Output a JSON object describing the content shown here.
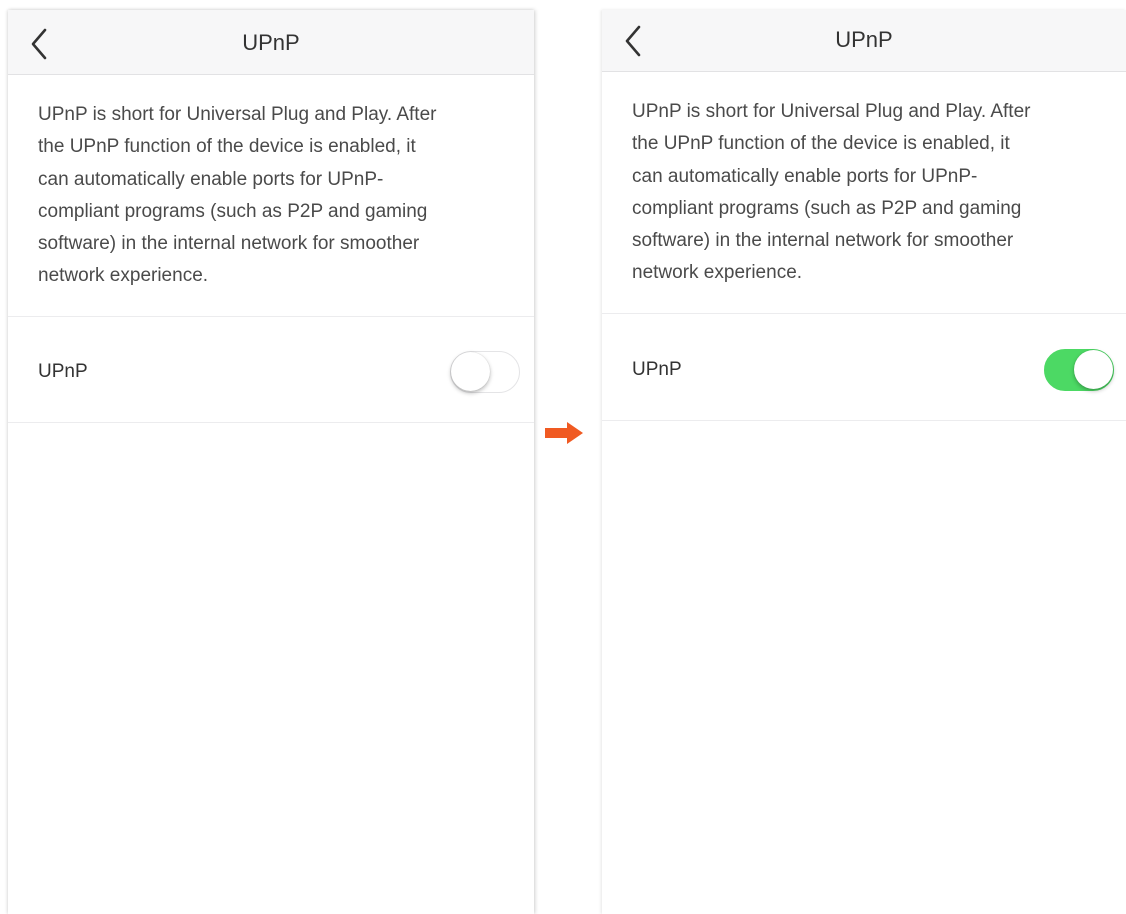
{
  "panels": [
    {
      "title": "UPnP",
      "description": "UPnP is short for Universal Plug and Play. After the UPnP function of the device is enabled, it can automatically enable ports for UPnP-compliant programs (such as P2P and gaming software) in the internal network for smoother network experience.",
      "description_lines": [
        "UPnP is short for Universal Plug and Play. After",
        "the UPnP function of the device is enabled, it",
        "can automatically enable ports for UPnP-",
        "compliant programs (such as P2P and gaming",
        "software) in the internal network for smoother",
        "network experience."
      ],
      "setting_label": "UPnP",
      "toggle_on": false
    },
    {
      "title": "UPnP",
      "description": "UPnP is short for Universal Plug and Play. After the UPnP function of the device is enabled, it can automatically enable ports for UPnP-compliant programs (such as P2P and gaming software) in the internal network for smoother network experience.",
      "description_lines": [
        "UPnP is short for Universal Plug and Play. After",
        "the UPnP function of the device is enabled, it",
        "can automatically enable ports for UPnP-",
        "compliant programs (such as P2P and gaming",
        "software) in the internal network for smoother",
        "network experience."
      ],
      "setting_label": "UPnP",
      "toggle_on": true
    }
  ],
  "icons": {
    "back": "chevron-left-icon",
    "transition": "arrow-right-icon"
  },
  "colors": {
    "toggle_on": "#4cd964",
    "arrow": "#f05a22"
  }
}
